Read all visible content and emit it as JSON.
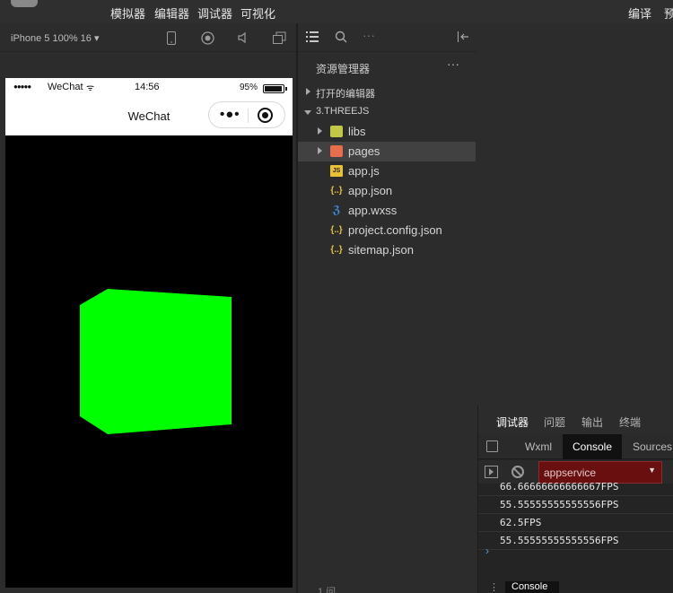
{
  "menu": {
    "items": [
      "模拟器",
      "编辑器",
      "调试器",
      "可视化"
    ],
    "compile": "编译",
    "preview": "预"
  },
  "simulator": {
    "device": "iPhone 5 100% 16 ▾",
    "status": {
      "signal": "●●●●●",
      "carrier": "WeChat",
      "wifi": "ᯤ",
      "time": "14:56",
      "battery_pct": "95%",
      "battery_level": 0.95
    },
    "nav_title": "WeChat",
    "cube_color": "#00ff00",
    "canvas_bg": "#000000"
  },
  "explorer": {
    "title": "资源管理器",
    "more": "···",
    "open_editors": "打开的编辑器",
    "project": "3.THREEJS",
    "items": [
      {
        "name": "libs",
        "type": "folder"
      },
      {
        "name": "pages",
        "type": "folder-pages"
      },
      {
        "name": "app.js",
        "type": "js"
      },
      {
        "name": "app.json",
        "type": "json"
      },
      {
        "name": "app.wxss",
        "type": "css"
      },
      {
        "name": "project.config.json",
        "type": "json"
      },
      {
        "name": "sitemap.json",
        "type": "json"
      }
    ],
    "footer": "1 问"
  },
  "debugger": {
    "tabs": [
      "调试器",
      "问题",
      "输出",
      "终端"
    ],
    "devtools_tabs": [
      "Wxml",
      "Console",
      "Sources"
    ],
    "context": "appservice",
    "logs": [
      "66.66666666666667FPS",
      "55.55555555555556FPS",
      "62.5FPS",
      "55.55555555555556FPS"
    ],
    "prompt": "›",
    "drawer_tab": "Console",
    "drawer_menu": "⋮"
  },
  "colors": {
    "accent_context": "#6a0f0f",
    "prompt": "#4a9ee8"
  }
}
